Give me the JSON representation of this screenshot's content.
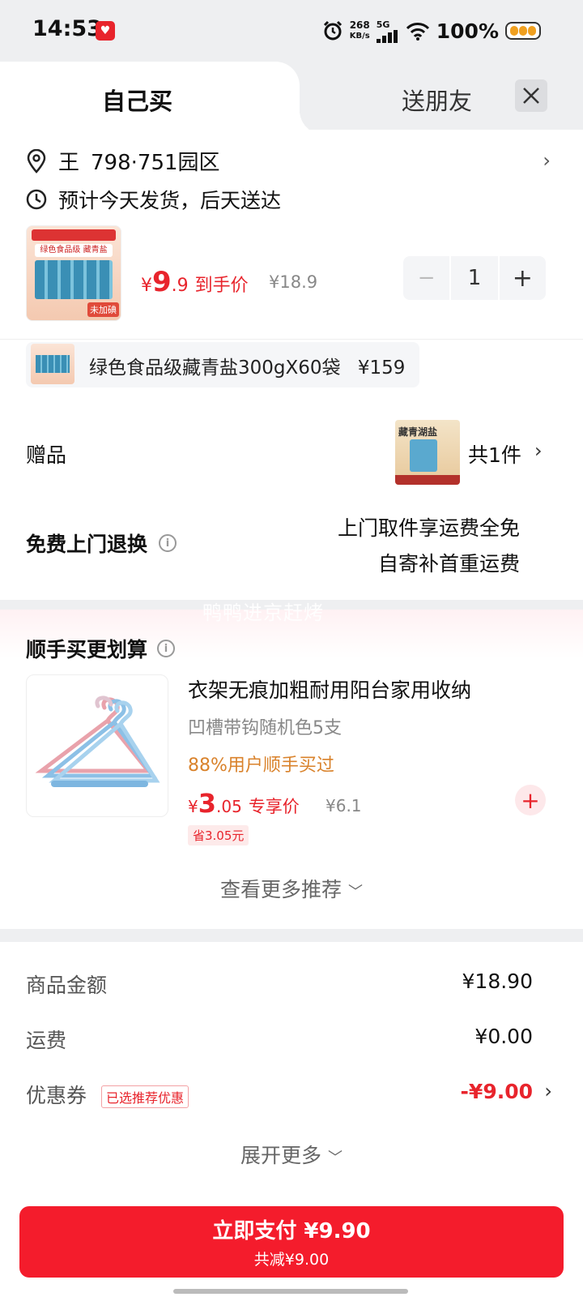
{
  "status_bar": {
    "time": "14:53",
    "net_speed_value": "268",
    "net_speed_unit": "KB/s",
    "network": "5G",
    "battery": "100%",
    "icons": [
      "app-notification-icon",
      "alarm-icon",
      "signal-icon",
      "wifi-icon",
      "battery-icon"
    ]
  },
  "tabs": {
    "self": "自己买",
    "friend": "送朋友"
  },
  "address": {
    "name": "王",
    "detail": "798·751园区"
  },
  "shipping": "预计今天发货，后天送达",
  "product": {
    "image_title": "绿色食品级 藏青盐",
    "image_badge": "未加碘",
    "currency": "¥",
    "price_int": "9",
    "price_dec": ".9",
    "price_label": "到手价",
    "original_price": "¥18.9",
    "quantity": "1"
  },
  "bundle": {
    "text": "绿色食品级藏青盐300gX60袋",
    "price": "¥159"
  },
  "gift": {
    "label": "赠品",
    "image_title": "藏青湖盐",
    "count": "共1件"
  },
  "returns": {
    "label": "免费上门退换",
    "line1": "上门取件享运费全免",
    "line2": "自寄补首重运费"
  },
  "watermark": "鸭鸭进京赶烤",
  "upsell": {
    "title": "顺手买更划算",
    "name": "衣架无痕加粗耐用阳台家用收纳",
    "spec": "凹槽带钩随机色5支",
    "bought": "88%用户顺手买过",
    "currency": "¥",
    "price_int": "3",
    "price_dec": ".05",
    "price_label": "专享价",
    "original_price": "¥6.1",
    "save": "省3.05元",
    "more": "查看更多推荐"
  },
  "summary": {
    "goods_label": "商品金额",
    "goods_value": "¥18.90",
    "shipping_label": "运费",
    "shipping_value": "¥0.00",
    "coupon_label": "优惠券",
    "coupon_tag": "已选推荐优惠",
    "coupon_value": "-¥9.00",
    "expand": "展开更多"
  },
  "pay": {
    "main": "立即支付 ¥9.90",
    "sub": "共减¥9.00"
  },
  "colors": {
    "accent": "#f41c2c",
    "price_red": "#e8242c",
    "orange": "#d9822b",
    "background": "#eeeff1"
  }
}
